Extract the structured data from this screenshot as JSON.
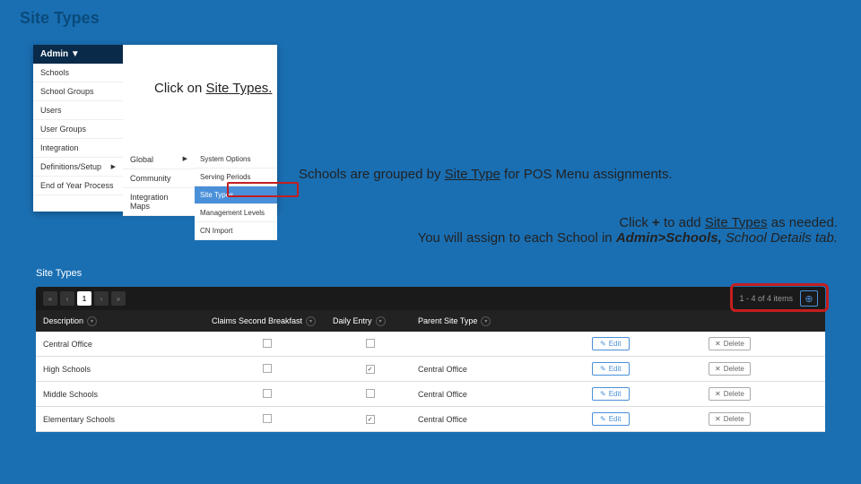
{
  "header": {
    "title": "Site Types"
  },
  "menu": {
    "title": "Admin ▼",
    "col1": [
      "Schools",
      "School Groups",
      "Users",
      "User Groups",
      "Integration",
      "Definitions/Setup",
      "End of Year Process"
    ],
    "col2": [
      "Global",
      "Community",
      "Integration Maps"
    ],
    "col3": [
      "System Options",
      "Serving Periods",
      "Site Types",
      "Management Levels",
      "CN Import"
    ]
  },
  "instructions": {
    "line1a": "Click on ",
    "line1b": "Site Types.",
    "line2a": "Schools are grouped by ",
    "line2b": "Site Type",
    "line2c": " for POS Menu assignments.",
    "line3a": "Click ",
    "line3b": "+",
    "line3c": " to add ",
    "line3d": "Site Types",
    "line3e": " as needed.",
    "line4a": "You will assign to each School in ",
    "line4b": "Admin>Schools, ",
    "line4c": "School Details tab."
  },
  "section": {
    "title": "Site Types"
  },
  "grid": {
    "pager": {
      "pages": [
        "«",
        "‹",
        "1",
        "›",
        "»"
      ],
      "info": "1 - 4 of 4 items"
    },
    "headers": {
      "desc": "Description",
      "claims": "Claims Second Breakfast",
      "daily": "Daily Entry",
      "parent": "Parent Site Type"
    },
    "rows": [
      {
        "desc": "Central Office",
        "claims": false,
        "daily": false,
        "parent": ""
      },
      {
        "desc": "High Schools",
        "claims": false,
        "daily": true,
        "parent": "Central Office"
      },
      {
        "desc": "Middle Schools",
        "claims": false,
        "daily": false,
        "parent": "Central Office"
      },
      {
        "desc": "Elementary Schools",
        "claims": false,
        "daily": true,
        "parent": "Central Office"
      }
    ],
    "editLabel": "Edit",
    "deleteLabel": "Delete"
  }
}
